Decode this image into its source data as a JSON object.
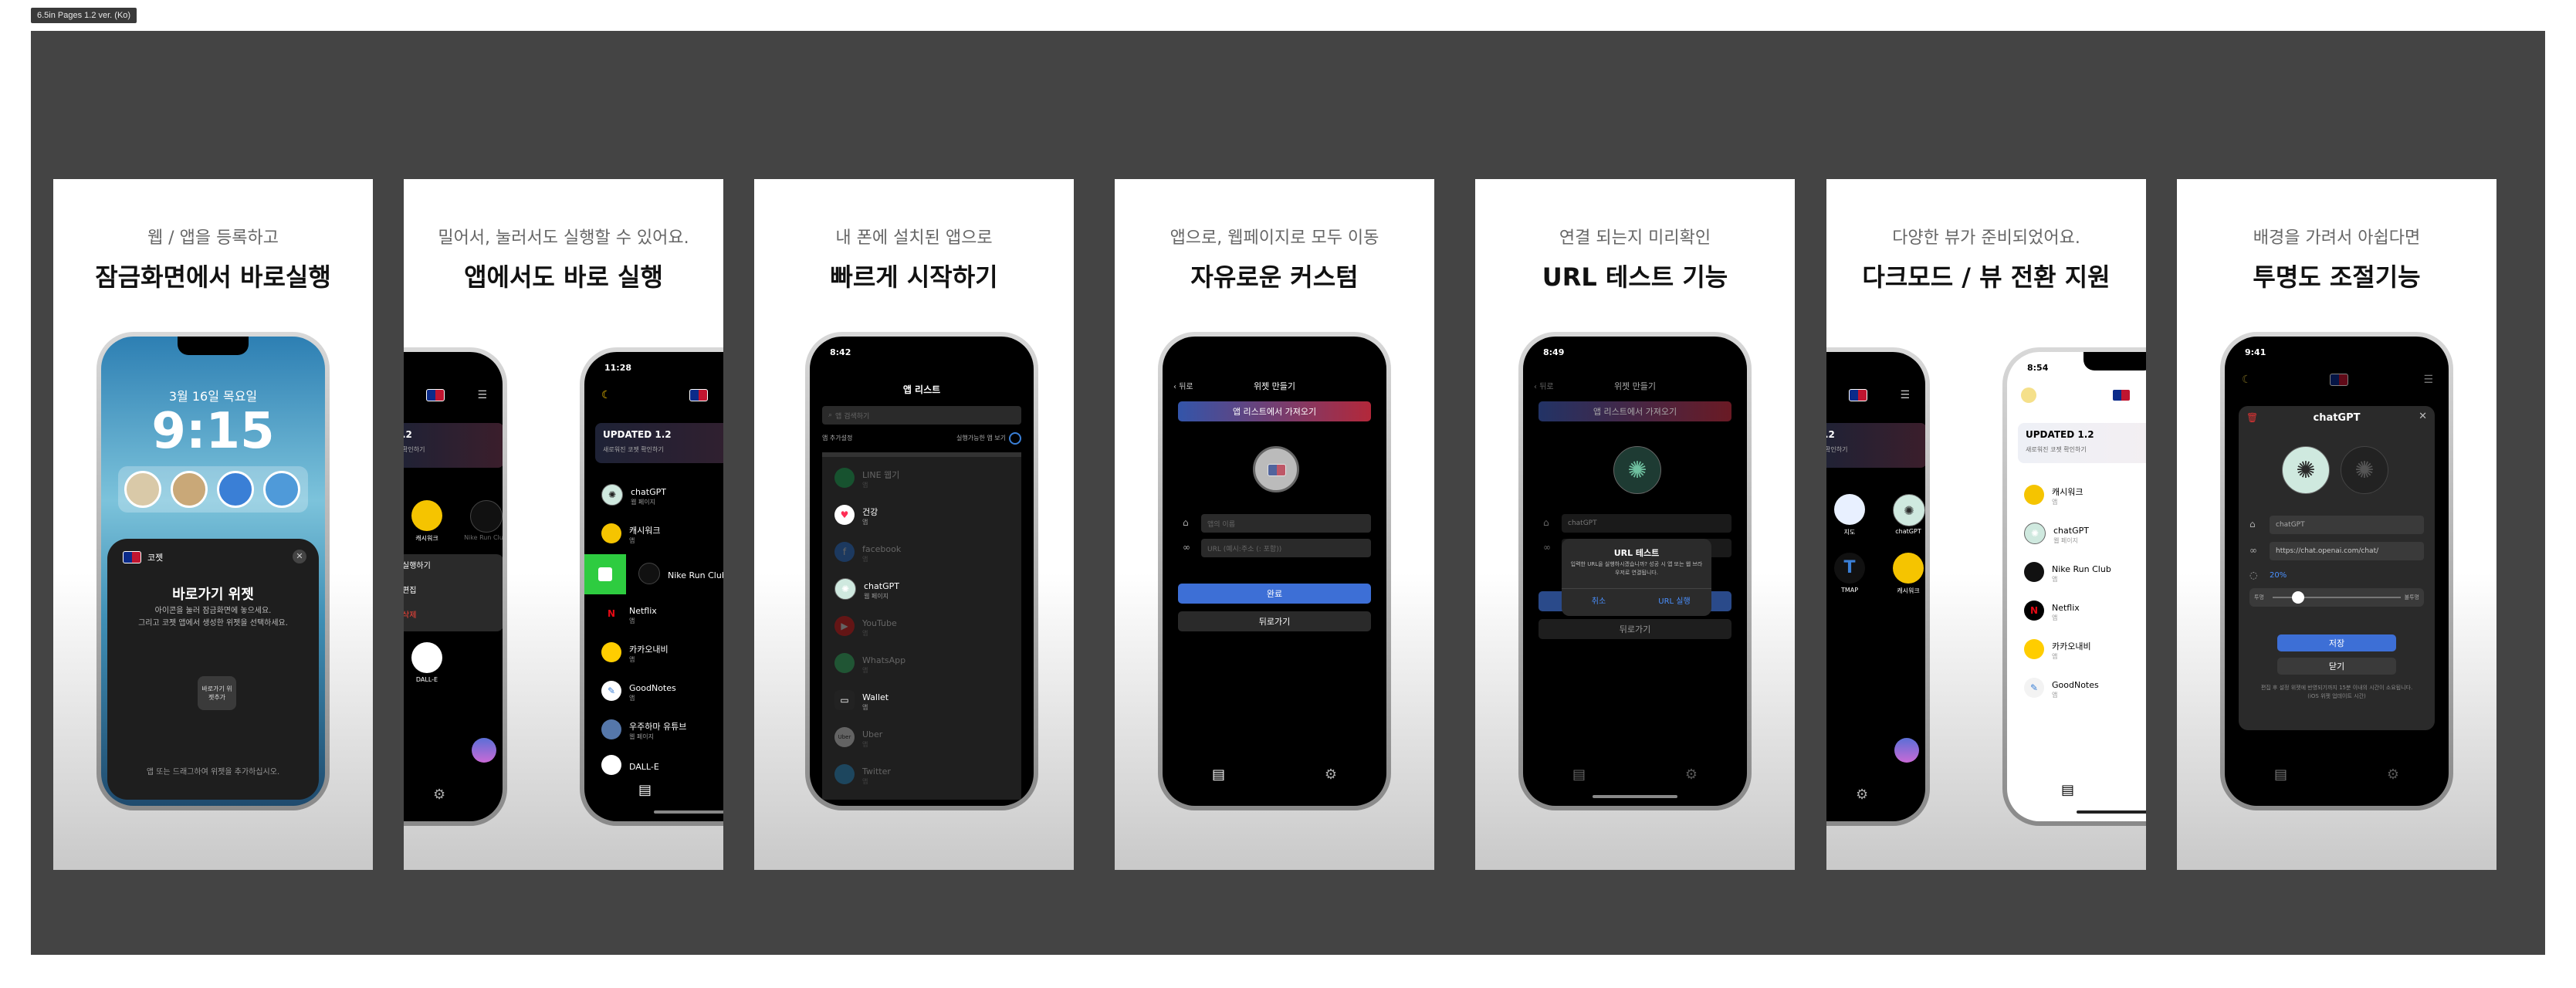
{
  "frame_label": "6.5in Pages 1.2 ver. (Ko)",
  "panels": [
    {
      "subtitle": "웹 / 앱을 등록하고",
      "title": "잠금화면에서 바로실행",
      "lock": {
        "date": "3월 16일 목요일",
        "time": "9:15",
        "widget_app": "코젯",
        "sheet_title": "바로가기 위젯",
        "sheet_desc1": "아이콘을 눌러 잠금화면에 놓으세요.",
        "sheet_desc2": "그리고 코젯 앱에서 생성한 위젯을 선택하세요.",
        "add_widget": "바로가기 위젯추가",
        "hint": "앱 또는 드래그하여 위젯을 추가하십시오."
      }
    },
    {
      "subtitle": "밀어서, 눌러서도 실행할 수 있어요.",
      "title": "앱에서도 바로 실행",
      "left": {
        "updated_partial": ".2",
        "sub_partial": "확인하기",
        "apps": [
          "캐시워크",
          "Nike Run Club",
          "DALL-E"
        ],
        "menu": [
          "실행하기",
          "편집",
          "삭제"
        ]
      },
      "right": {
        "time": "11:28",
        "updated_title": "UPDATED 1.2",
        "updated_sub": "새로워진 코젯 확인하기",
        "apps": [
          {
            "name": "chatGPT",
            "sub": "웹 페이지"
          },
          {
            "name": "캐시워크",
            "sub": "앱"
          },
          {
            "name": "Nike Run Club",
            "sub": ""
          },
          {
            "name": "Netflix",
            "sub": "앱"
          },
          {
            "name": "카카오내비",
            "sub": "앱"
          },
          {
            "name": "GoodNotes",
            "sub": "앱"
          },
          {
            "name": "우주하마 유튜브",
            "sub": "웹 페이지"
          },
          {
            "name": "DALL-E",
            "sub": ""
          }
        ]
      }
    },
    {
      "subtitle": "내 폰에 설치된 앱으로",
      "title": "빠르게 시작하기",
      "list": {
        "time": "8:42",
        "header": "앱 리스트",
        "search": "앱 검색하기",
        "add_label": "앱 추가설정",
        "toggle_label": "실행가능한 앱 보기",
        "apps": [
          {
            "name": "LINE 웹기",
            "sub": "앱",
            "dim": true
          },
          {
            "name": "건강",
            "sub": "앱",
            "dim": false
          },
          {
            "name": "facebook",
            "sub": "앱",
            "dim": true
          },
          {
            "name": "chatGPT",
            "sub": "웹 페이지",
            "dim": false
          },
          {
            "name": "YouTube",
            "sub": "앱",
            "dim": true
          },
          {
            "name": "WhatsApp",
            "sub": "앱",
            "dim": true
          },
          {
            "name": "Wallet",
            "sub": "앱",
            "dim": false
          },
          {
            "name": "Uber",
            "sub": "앱",
            "dim": true
          },
          {
            "name": "Twitter",
            "sub": "앱",
            "dim": true
          }
        ]
      }
    },
    {
      "subtitle": "앱으로, 웹페이지로 모두 이동",
      "title": "자유로운 커스텀",
      "create": {
        "back": "뒤로",
        "header": "위젯 만들기",
        "import_btn": "앱 리스트에서 가져오기",
        "name_placeholder": "앱의 이름",
        "url_placeholder": "URL (예시:주소 (: 포함))",
        "done": "완료",
        "go_back": "뒤로가기"
      }
    },
    {
      "subtitle": "연결 되는지 미리확인",
      "title": "URL 테스트 기능",
      "test": {
        "time": "8:49",
        "back": "뒤로",
        "header": "위젯 만들기",
        "import_btn": "앱 리스트에서 가져오기",
        "name_value": "chatGPT",
        "dialog_title": "URL 테스트",
        "dialog_desc": "입력한 URL을 실행하시겠습니까? 성공 시 앱 또는 웹 브라우저로 연결됩니다.",
        "cancel": "취소",
        "run": "URL 실행",
        "done": "완료",
        "go_back": "뒤로가기"
      }
    },
    {
      "subtitle": "다양한 뷰가 준비되었어요.",
      "title": "다크모드 / 뷰 전환 지원",
      "left": {
        "updated_partial": ".2",
        "sub_partial": "확인하기",
        "apps": [
          "지도",
          "chatGPT",
          "TMAP",
          "캐시워크"
        ]
      },
      "right": {
        "time": "8:54",
        "updated_title": "UPDATED 1.2",
        "updated_sub": "새로워진 코젯 확인하기",
        "apps": [
          {
            "name": "캐시워크",
            "sub": "앱"
          },
          {
            "name": "chatGPT",
            "sub": "웹 페이지"
          },
          {
            "name": "Nike Run Club",
            "sub": "앱"
          },
          {
            "name": "Netflix",
            "sub": "앱"
          },
          {
            "name": "카카오내비",
            "sub": "앱"
          },
          {
            "name": "GoodNotes",
            "sub": "앱"
          }
        ]
      }
    },
    {
      "subtitle": "배경을 가려서 아쉽다면",
      "title": "투명도 조절기능",
      "opacity": {
        "time": "9:41",
        "header": "chatGPT",
        "name_value": "chatGPT",
        "url_value": "https://chat.openai.com/chat/",
        "percent": "20%",
        "slider_value": 0.2,
        "slider_min": "투명",
        "slider_max": "불투명",
        "save": "저장",
        "close": "닫기",
        "note": "편집 후 설정 위젯에 반영되기까지 15분 이내의 시간이 소요됩니다. (iOS 위젯 업데이트 시간)"
      }
    }
  ],
  "colors": {
    "canvas": "#444444",
    "import_gradient": "#3355aa",
    "primary_btn": "#3d6fd6"
  }
}
